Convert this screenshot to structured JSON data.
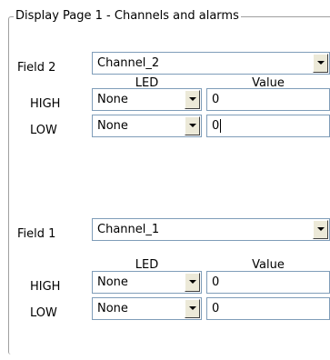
{
  "group": {
    "title": "Display Page 1 - Channels and alarms"
  },
  "headers": {
    "led": "LED",
    "value": "Value"
  },
  "fields": [
    {
      "label": "Field 2",
      "channel": "Channel_2",
      "high": {
        "label": "HIGH",
        "led": "None",
        "value": "0"
      },
      "low": {
        "label": "LOW",
        "led": "None",
        "value": "0"
      }
    },
    {
      "label": "Field 1",
      "channel": "Channel_1",
      "high": {
        "label": "HIGH",
        "led": "None",
        "value": "0"
      },
      "low": {
        "label": "LOW",
        "led": "None",
        "value": "0"
      }
    }
  ]
}
